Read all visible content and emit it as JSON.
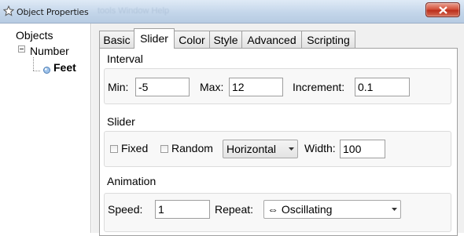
{
  "window": {
    "title": "Object Properties",
    "background_menu": "tools   Window   Help",
    "close_icon": "close-x-icon"
  },
  "tree": {
    "root_label": "Objects",
    "group_label": "Number",
    "item_label": "Feet"
  },
  "tabs": [
    {
      "label": "Basic"
    },
    {
      "label": "Slider"
    },
    {
      "label": "Color"
    },
    {
      "label": "Style"
    },
    {
      "label": "Advanced"
    },
    {
      "label": "Scripting"
    }
  ],
  "active_tab": "Slider",
  "interval": {
    "title": "Interval",
    "min_label": "Min:",
    "min_value": "-5",
    "max_label": "Max:",
    "max_value": "12",
    "increment_label": "Increment:",
    "increment_value": "0.1"
  },
  "slider": {
    "title": "Slider",
    "fixed_label": "Fixed",
    "fixed_checked": false,
    "random_label": "Random",
    "random_checked": false,
    "orientation_value": "Horizontal",
    "width_label": "Width:",
    "width_value": "100"
  },
  "animation": {
    "title": "Animation",
    "speed_label": "Speed:",
    "speed_value": "1",
    "repeat_label": "Repeat:",
    "repeat_value": "⇔ Oscillating"
  },
  "colors": {
    "close_button": "#c8432d",
    "titlebar": "#c4d6ea"
  }
}
